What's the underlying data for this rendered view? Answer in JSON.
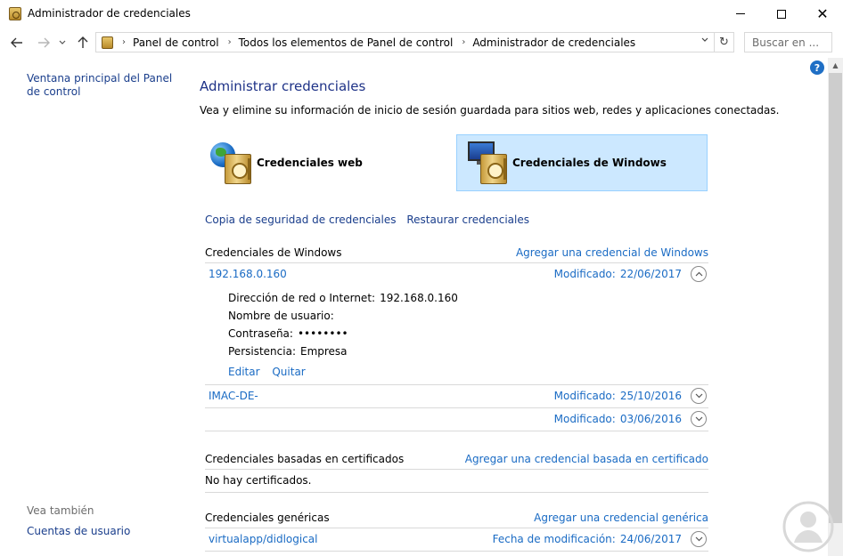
{
  "window": {
    "title": "Administrador de credenciales",
    "icon": "credential-manager-icon"
  },
  "nav": {
    "breadcrumbs": [
      "Panel de control",
      "Todos los elementos de Panel de control",
      "Administrador de credenciales"
    ],
    "search_placeholder": "Buscar en ..."
  },
  "left": {
    "main_link": "Ventana principal del Panel de control",
    "see_also": "Vea también",
    "user_accounts": "Cuentas de usuario"
  },
  "main": {
    "title": "Administrar credenciales",
    "description": "Vea y elimine su información de inicio de sesión guardada para sitios web, redes y aplicaciones conectadas.",
    "tiles": {
      "web": "Credenciales web",
      "windows": "Credenciales de Windows"
    },
    "backup_link": "Copia de seguridad de credenciales",
    "restore_link": "Restaurar credenciales"
  },
  "windows_section": {
    "title": "Credenciales de Windows",
    "add": "Agregar una credencial de Windows",
    "modified_label": "Modificado:",
    "items": [
      {
        "name": "192.168.0.160",
        "date": "22/06/2017",
        "expanded": true
      },
      {
        "name": "IMAC-DE-",
        "date": "25/10/2016",
        "expanded": false
      },
      {
        "name": "",
        "date": "03/06/2016",
        "expanded": false
      }
    ],
    "detail": {
      "address_label": "Dirección de red o Internet:",
      "address_value": "192.168.0.160",
      "user_label": "Nombre de usuario:",
      "user_value": "",
      "password_label": "Contraseña:",
      "password_value": "••••••••",
      "persistence_label": "Persistencia:",
      "persistence_value": "Empresa",
      "edit": "Editar",
      "remove": "Quitar"
    }
  },
  "cert_section": {
    "title": "Credenciales basadas en certificados",
    "add": "Agregar una credencial basada en certificado",
    "empty": "No hay certificados."
  },
  "generic_section": {
    "title": "Credenciales genéricas",
    "add": "Agregar una credencial genérica",
    "modified_label": "Fecha de modificación:",
    "items": [
      {
        "name": "virtualapp/didlogical",
        "date": "24/06/2017"
      }
    ]
  },
  "colors": {
    "link": "#1a6bc4",
    "heading": "#1e3287",
    "selected_tile": "#cce8ff",
    "help": "#1f6fc5"
  }
}
